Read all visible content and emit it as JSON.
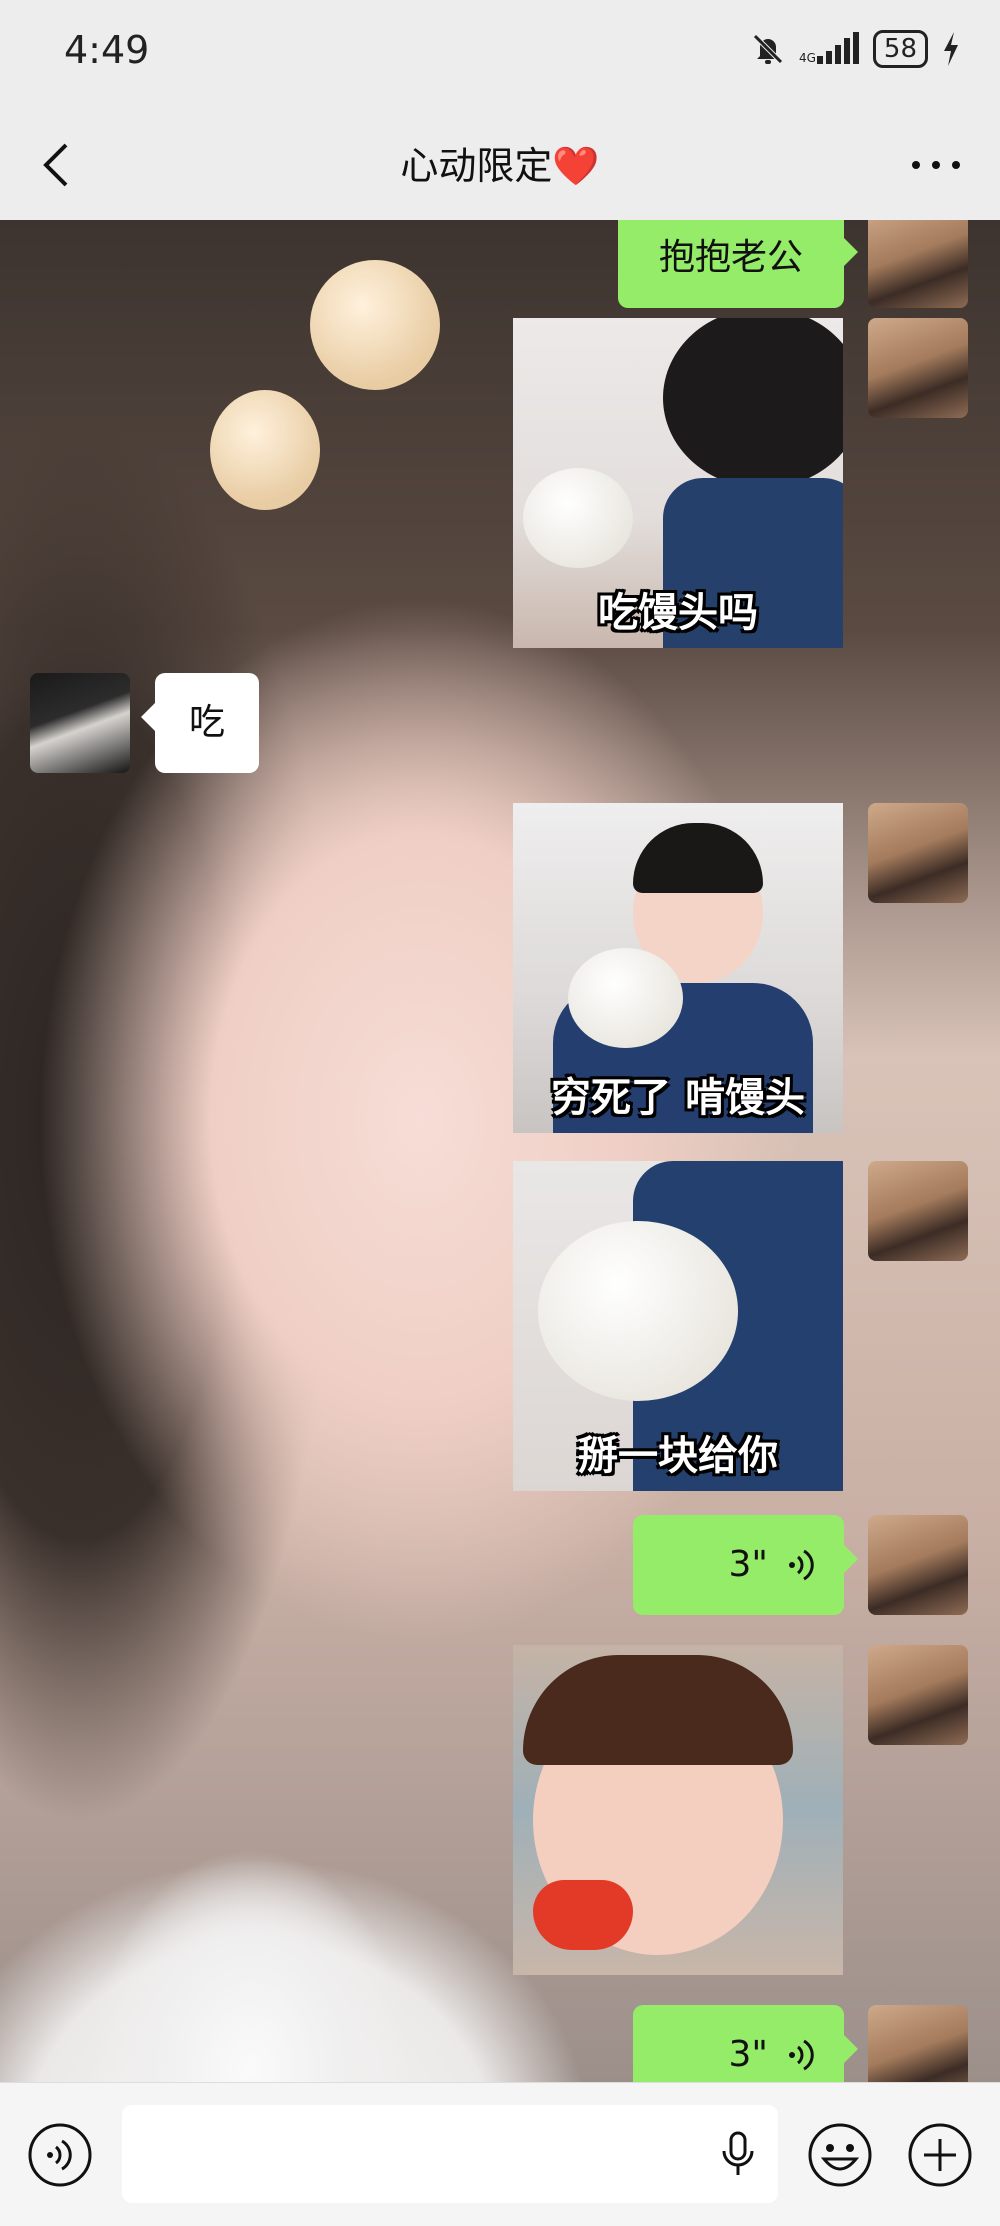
{
  "status_bar": {
    "time": "4:49",
    "battery": "58"
  },
  "header": {
    "title": "心动限定❤️"
  },
  "messages": {
    "m1": {
      "text": "抱抱老公"
    },
    "m2": {
      "caption": "吃馒头吗"
    },
    "m3": {
      "text": "吃"
    },
    "m4": {
      "caption": "穷死了 啃馒头"
    },
    "m5": {
      "caption": "掰一块给你"
    },
    "m6": {
      "duration": "3\""
    },
    "m8": {
      "duration": "3\""
    }
  }
}
